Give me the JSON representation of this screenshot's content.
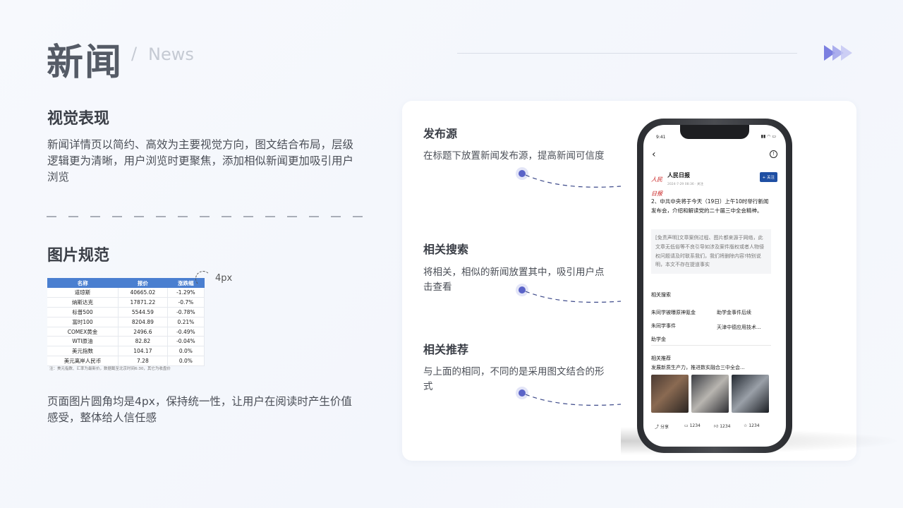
{
  "header": {
    "title": "新闻",
    "slash": "/",
    "subtitle": "News"
  },
  "visual": {
    "title": "视觉表现",
    "lines": [
      "新闻详情页以简约、高效为主要视觉方向，图文结合布局，层级",
      "逻辑更为清晰，用户浏览时更聚焦，添加相似新闻更加吸引用户",
      "浏览"
    ]
  },
  "image_spec": {
    "title": "图片规范",
    "radius_label": "4px",
    "lines": [
      "页面图片圆角均是4px，保持统一性，让用户在阅读时产生价值",
      "感受，整体给人信任感"
    ]
  },
  "table": {
    "headers": [
      "名称",
      "报价",
      "涨跌幅"
    ],
    "rows": [
      [
        "道琼斯",
        "40665.02",
        "-1.29%"
      ],
      [
        "纳斯达克",
        "17871.22",
        "-0.7%"
      ],
      [
        "标普500",
        "5544.59",
        "-0.78%"
      ],
      [
        "富时100",
        "8204.89",
        "0.21%"
      ],
      [
        "COMEX黄金",
        "2496.6",
        "-0.49%"
      ],
      [
        "WTI原油",
        "82.82",
        "-0.04%"
      ],
      [
        "美元指数",
        "104.17",
        "0.0%"
      ],
      [
        "美元离岸人民币",
        "7.28",
        "0.0%"
      ]
    ],
    "note": "注：美元指数、汇率为最新价，数据截至北京时间6:30，其它为收盘价"
  },
  "features": [
    {
      "title": "发布源",
      "desc": [
        "在标题下放置新闻发布源，提高新闻可信度"
      ]
    },
    {
      "title": "相关搜索",
      "desc": [
        "将相关，相似的新闻放置其中，吸引用户点",
        "击查看"
      ]
    },
    {
      "title": "相关推荐",
      "desc": [
        "与上面的相同，不同的是采用图文结合的形",
        "式"
      ]
    }
  ],
  "phone": {
    "time": "9:41",
    "source": "人民日报",
    "logo_text": "人民日报",
    "meta": "2024-7-29  08:36  · 关注",
    "follow": "+ 关注",
    "headline": "2、中共中央将于今天（19日）上午10时举行新闻发布会，介绍和解读党的二十届三中全会精神。",
    "disclaimer": "[免责声明]文章案例过程、图片都来源于网络，此文章无低俗等不良引导如涉及案件版权或者人物侵权问题请及时联系我们，我们将删除内容!特别说明，本文不存在提道事实",
    "related_search_title": "相关搜索",
    "searches": [
      "朱同学被曝原神氪金",
      "助学金事件后续",
      "朱同学事件",
      "天津中德应用技术...",
      "助学金"
    ],
    "related_rec_title": "相关推荐",
    "rec_headline": "发展新质生产力，推进数实融合三中全会...",
    "share": "分享",
    "comments": "1234",
    "likes": "1234",
    "stars": "1234"
  },
  "colors": {
    "accent": "#5a63c8",
    "table_header": "#4a7fd0",
    "follow_btn": "#1f4fa3"
  }
}
